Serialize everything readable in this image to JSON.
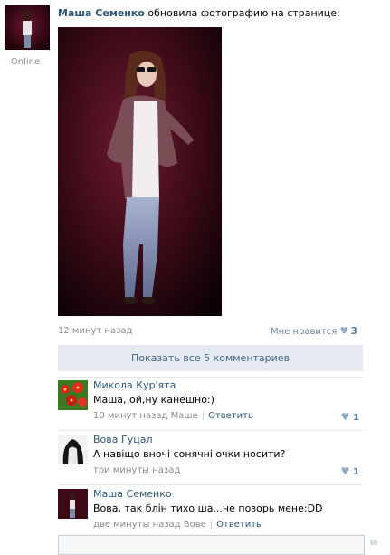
{
  "post": {
    "author": "Маша Семенко",
    "action": "обновила фотографию на странице:",
    "status": "Online",
    "time": "12 минут назад",
    "like_label": "Мне нравится",
    "like_count": "3",
    "show_comments": "Показать все 5 комментариев"
  },
  "comments": [
    {
      "name": "Микола Кур'ята",
      "text": "Маша, ой,ну канешно:)",
      "time": "10 минут назад",
      "reply_to": "Маше",
      "reply": "Ответить",
      "likes": "1"
    },
    {
      "name": "Вова Гуцал",
      "text": "А навіщо вночі сонячні очки носити?",
      "time": "три минуты назад",
      "likes": "1"
    },
    {
      "name": "Маша Семенко",
      "text": "Вова, так блін тихо ша...не позорь мене:DD",
      "time": "две минуты назад",
      "reply_to": "Вове",
      "reply": "Ответить"
    }
  ],
  "icons": {
    "heart": "heart-icon"
  },
  "colors": {
    "link": "#2b587a",
    "button_bg": "#e5eaf0",
    "button_text": "#45688e"
  }
}
